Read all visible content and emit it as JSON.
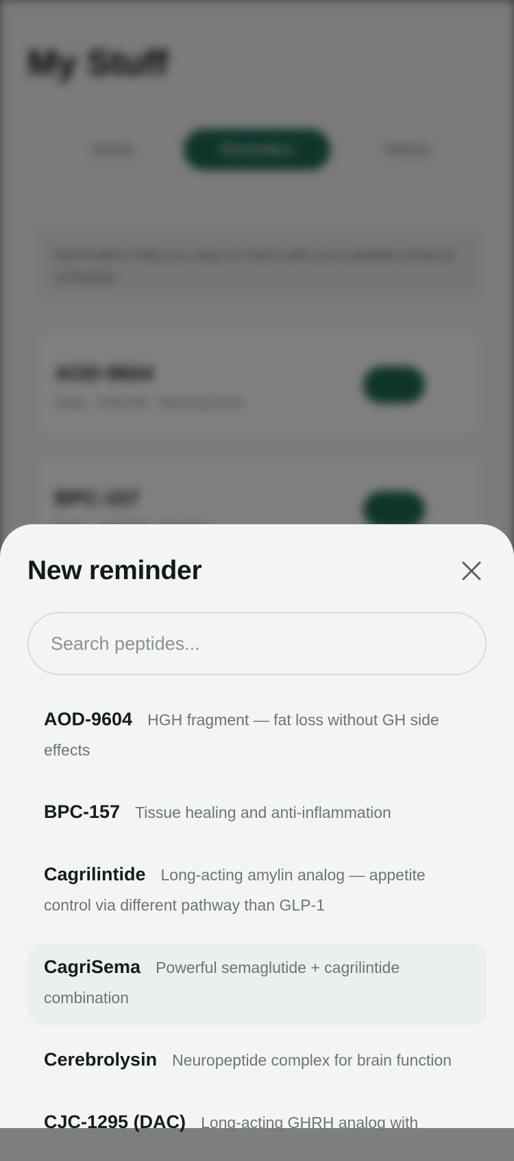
{
  "background": {
    "title": "My Stuff",
    "tabs": [
      "Active",
      "Reminders",
      "History"
    ],
    "banner": "Reminders help you stay on track with your peptide protocol schedule.",
    "cards": [
      {
        "name": "AOD-9604",
        "sub": "Daily · 8:00 AM · Morning dose"
      },
      {
        "name": "BPC-157",
        "sub": "Daily · 9:00 PM · Evening"
      }
    ]
  },
  "sheet": {
    "title": "New reminder",
    "search": {
      "placeholder": "Search peptides...",
      "value": ""
    },
    "items": [
      {
        "name": "AOD-9604",
        "desc": "HGH fragment — fat loss without GH side effects"
      },
      {
        "name": "BPC-157",
        "desc": "Tissue healing and anti-inflammation"
      },
      {
        "name": "Cagrilintide",
        "desc": "Long-acting amylin analog — appetite control via different pathway than GLP-1"
      },
      {
        "name": "CagriSema",
        "desc": "Powerful semaglutide + cagrilintide combination"
      },
      {
        "name": "Cerebrolysin",
        "desc": "Neuropeptide complex for brain function"
      },
      {
        "name": "CJC-1295 (DAC)",
        "desc": "Long-acting GHRH analog with"
      }
    ]
  },
  "colors": {
    "accent": "#1f6b57",
    "sheet_bg": "#f3f5f4",
    "highlight": "#ebefee"
  },
  "icons": {
    "close": "close-icon"
  }
}
